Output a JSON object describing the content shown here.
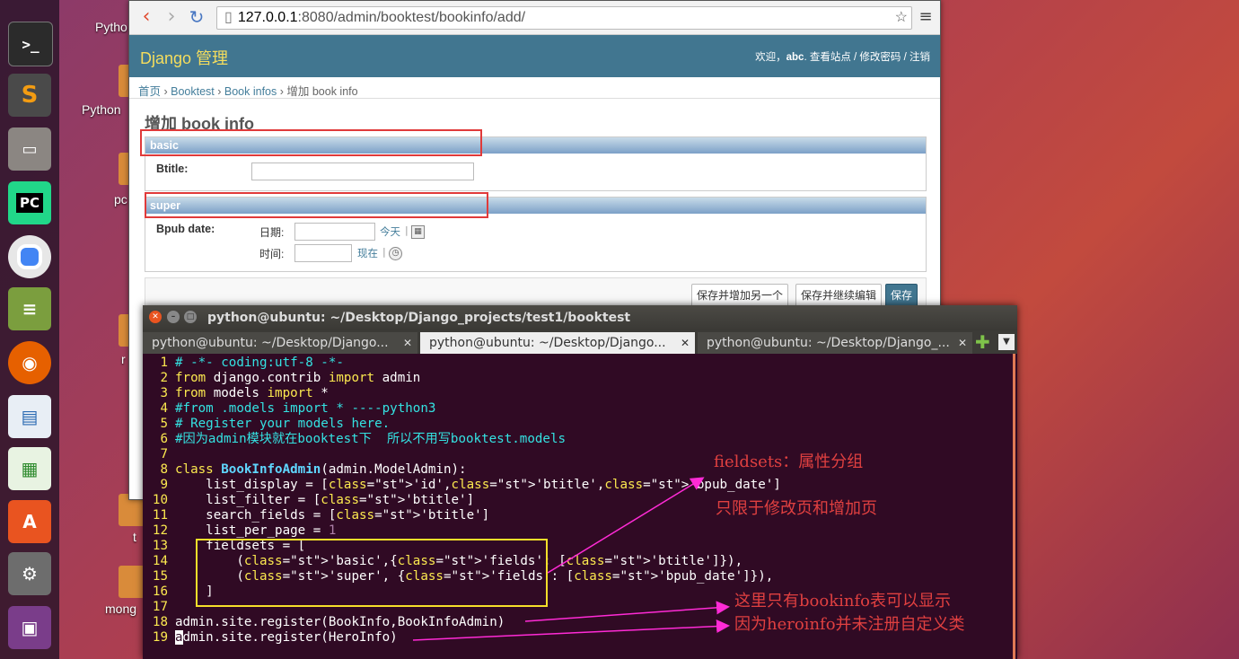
{
  "desktop": {
    "files": [
      "Pytho",
      "Python",
      "pc",
      "r",
      "t",
      "mong"
    ]
  },
  "launcher": {
    "icons": [
      "terminal-icon",
      "sublime-text-icon",
      "files-icon",
      "pycharm-icon",
      "chrome-icon",
      "books-icon",
      "firefox-icon",
      "writer-icon",
      "calc-icon",
      "software-center-icon",
      "settings-icon",
      "workspace-icon"
    ]
  },
  "browser": {
    "url_host": "127.0.0.1",
    "url_path": ":8080/admin/booktest/bookinfo/add/",
    "site_title": "Django 管理",
    "welcome": "欢迎，",
    "username": "abc",
    "user_links": ". 查看站点 / 修改密码 / 注销",
    "breadcrumbs": [
      "首页",
      "Booktest",
      "Book infos",
      "增加 book info"
    ],
    "page_title": "增加 book info",
    "fieldsets": [
      {
        "name": "basic",
        "fields": [
          {
            "label": "Btitle:"
          }
        ]
      },
      {
        "name": "super",
        "fields": [
          {
            "label": "Bpub date:",
            "date_label": "日期:",
            "today": "今天",
            "time_label": "时间:",
            "now": "现在"
          }
        ]
      }
    ],
    "buttons": {
      "save_add_another": "保存并增加另一个",
      "save_continue": "保存并继续编辑",
      "save": "保存"
    }
  },
  "terminal": {
    "title": "python@ubuntu: ~/Desktop/Django_projects/test1/booktest",
    "tabs": [
      "python@ubuntu: ~/Desktop/Django...",
      "python@ubuntu: ~/Desktop/Django...",
      "python@ubuntu: ~/Desktop/Django_..."
    ],
    "active_tab": 1,
    "code_lines": [
      "# -*- coding:utf-8 -*-",
      "from django.contrib import admin",
      "from models import *",
      "#from .models import * ----python3",
      "# Register your models here.",
      "#因为admin模块就在booktest下  所以不用写booktest.models",
      "",
      "class BookInfoAdmin(admin.ModelAdmin):",
      "    list_display = ['id','btitle','bpub_date']",
      "    list_filter = ['btitle']",
      "    search_fields = ['btitle']",
      "    list_per_page = 1",
      "    fieldsets = [",
      "        ('basic',{'fields': ['btitle']}),",
      "        ('super', {'fields': ['bpub_date']}),",
      "    ]",
      "",
      "admin.site.register(BookInfo,BookInfoAdmin)",
      "admin.site.register(HeroInfo)"
    ]
  },
  "annotations": {
    "fieldsets_note": "fieldsets：属性分组",
    "scope_note": "只限于修改页和增加页",
    "bookinfo_note": "这里只有bookinfo表可以显示",
    "heroinfo_note": "因为heroinfo并未注册自定义类"
  },
  "colors": {
    "django_header": "#417690",
    "terminal_bg": "#300a24",
    "annotation_red": "#e04040",
    "annotation_magenta": "#ff2bd6"
  }
}
